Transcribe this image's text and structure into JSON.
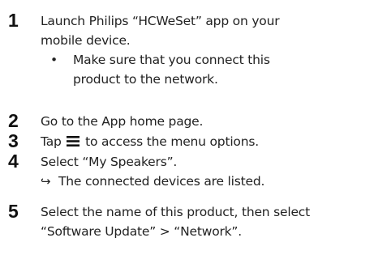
{
  "steps": [
    {
      "number": "1",
      "lines": [
        "Launch Philips “HCWeSet” app on your",
        "mobile device."
      ],
      "bullet": {
        "symbol": "•",
        "lines": [
          "Make sure that you connect this",
          "product to the network."
        ]
      }
    },
    {
      "number": "2",
      "text": "Go to the App home page."
    },
    {
      "number": "3",
      "text_before": "Tap",
      "icon": "menu-icon",
      "text_after": "to access the menu options."
    },
    {
      "number": "4",
      "text": "Select “My Speakers”.",
      "result": {
        "symbol": "↪",
        "text": "The connected devices are listed."
      }
    },
    {
      "number": "5",
      "lines": [
        "Select the name of this product, then select",
        "“Software Update” > “Network”."
      ]
    }
  ]
}
